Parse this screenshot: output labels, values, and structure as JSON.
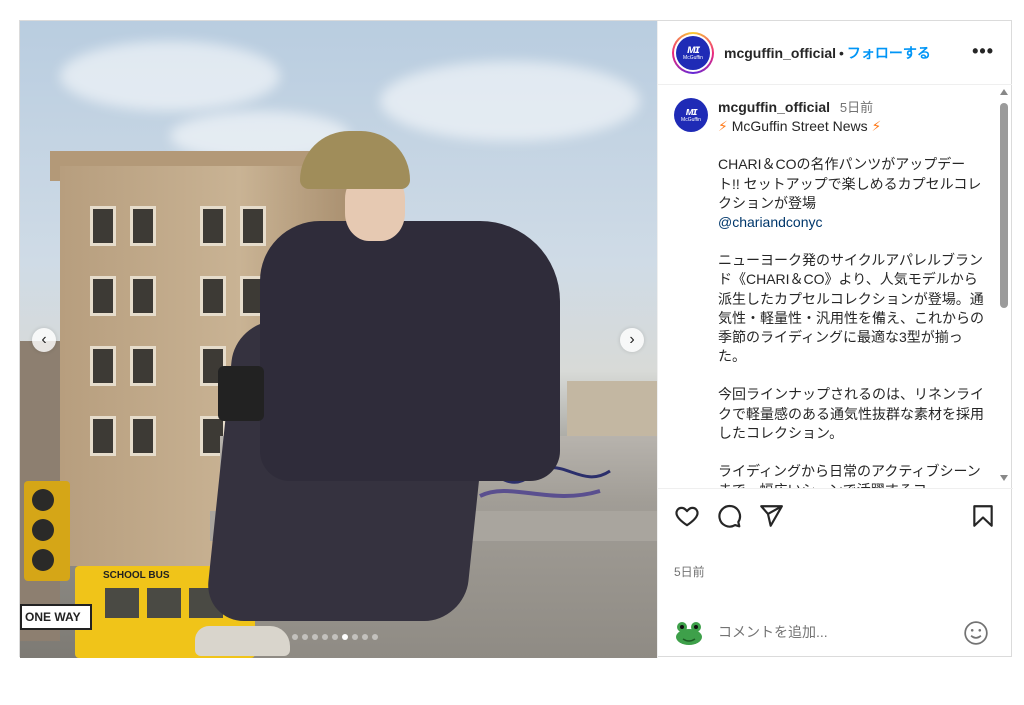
{
  "post": {
    "username": "mcguffin_official",
    "follow_separator": "•",
    "follow_label": "フォローする",
    "more_label": "•••",
    "avatar": {
      "mark": "ᴍɪ",
      "name": "McGuffin"
    }
  },
  "photo": {
    "alt": "Man in cap and navy tracksuit sitting on a graffiti-covered wall holding a camera",
    "sign_text": "ONE WAY",
    "bus_text": "SCHOOL BUS",
    "carousel": {
      "total": 9,
      "active_index": 5
    },
    "prev_icon": "chevron-left-icon",
    "next_icon": "chevron-right-icon"
  },
  "caption": {
    "username": "mcguffin_official",
    "time": "5日前",
    "headline": "McGuffin Street News",
    "headline_icon": "lightning-icon",
    "para1": "CHARI＆COの名作パンツがアップデート!! セットアップで楽しめるカプセルコレクションが登場",
    "mention": "@chariandconyc",
    "para2": "ニューヨーク発のサイクルアパレルブランド《CHARI＆CO》より、人気モデルから派生したカプセルコレクションが登場。通気性・軽量性・汎用性を備え、これからの季節のライディングに最適な3型が揃った。",
    "para3": "今回ラインナップされるのは、リネンライクで軽量感のある通気性抜群な素材を採用したコレクション。",
    "para4": "ライディングから日常のアクティブシーンまで、幅広いシーンで活躍するコ"
  },
  "actions": {
    "like_icon": "heart-icon",
    "comment_icon": "comment-icon",
    "share_icon": "send-icon",
    "save_icon": "bookmark-icon"
  },
  "post_time": "5日前",
  "comment_box": {
    "placeholder": "コメントを追加...",
    "emoji_icon": "emoji-icon",
    "user_avatar": "frog-avatar"
  },
  "colors": {
    "accent": "#0095f6",
    "brand_avatar": "#1f2bb6",
    "text": "#262626",
    "muted": "#737373",
    "mention": "#00376b",
    "bolt": "#ff7a1a"
  }
}
